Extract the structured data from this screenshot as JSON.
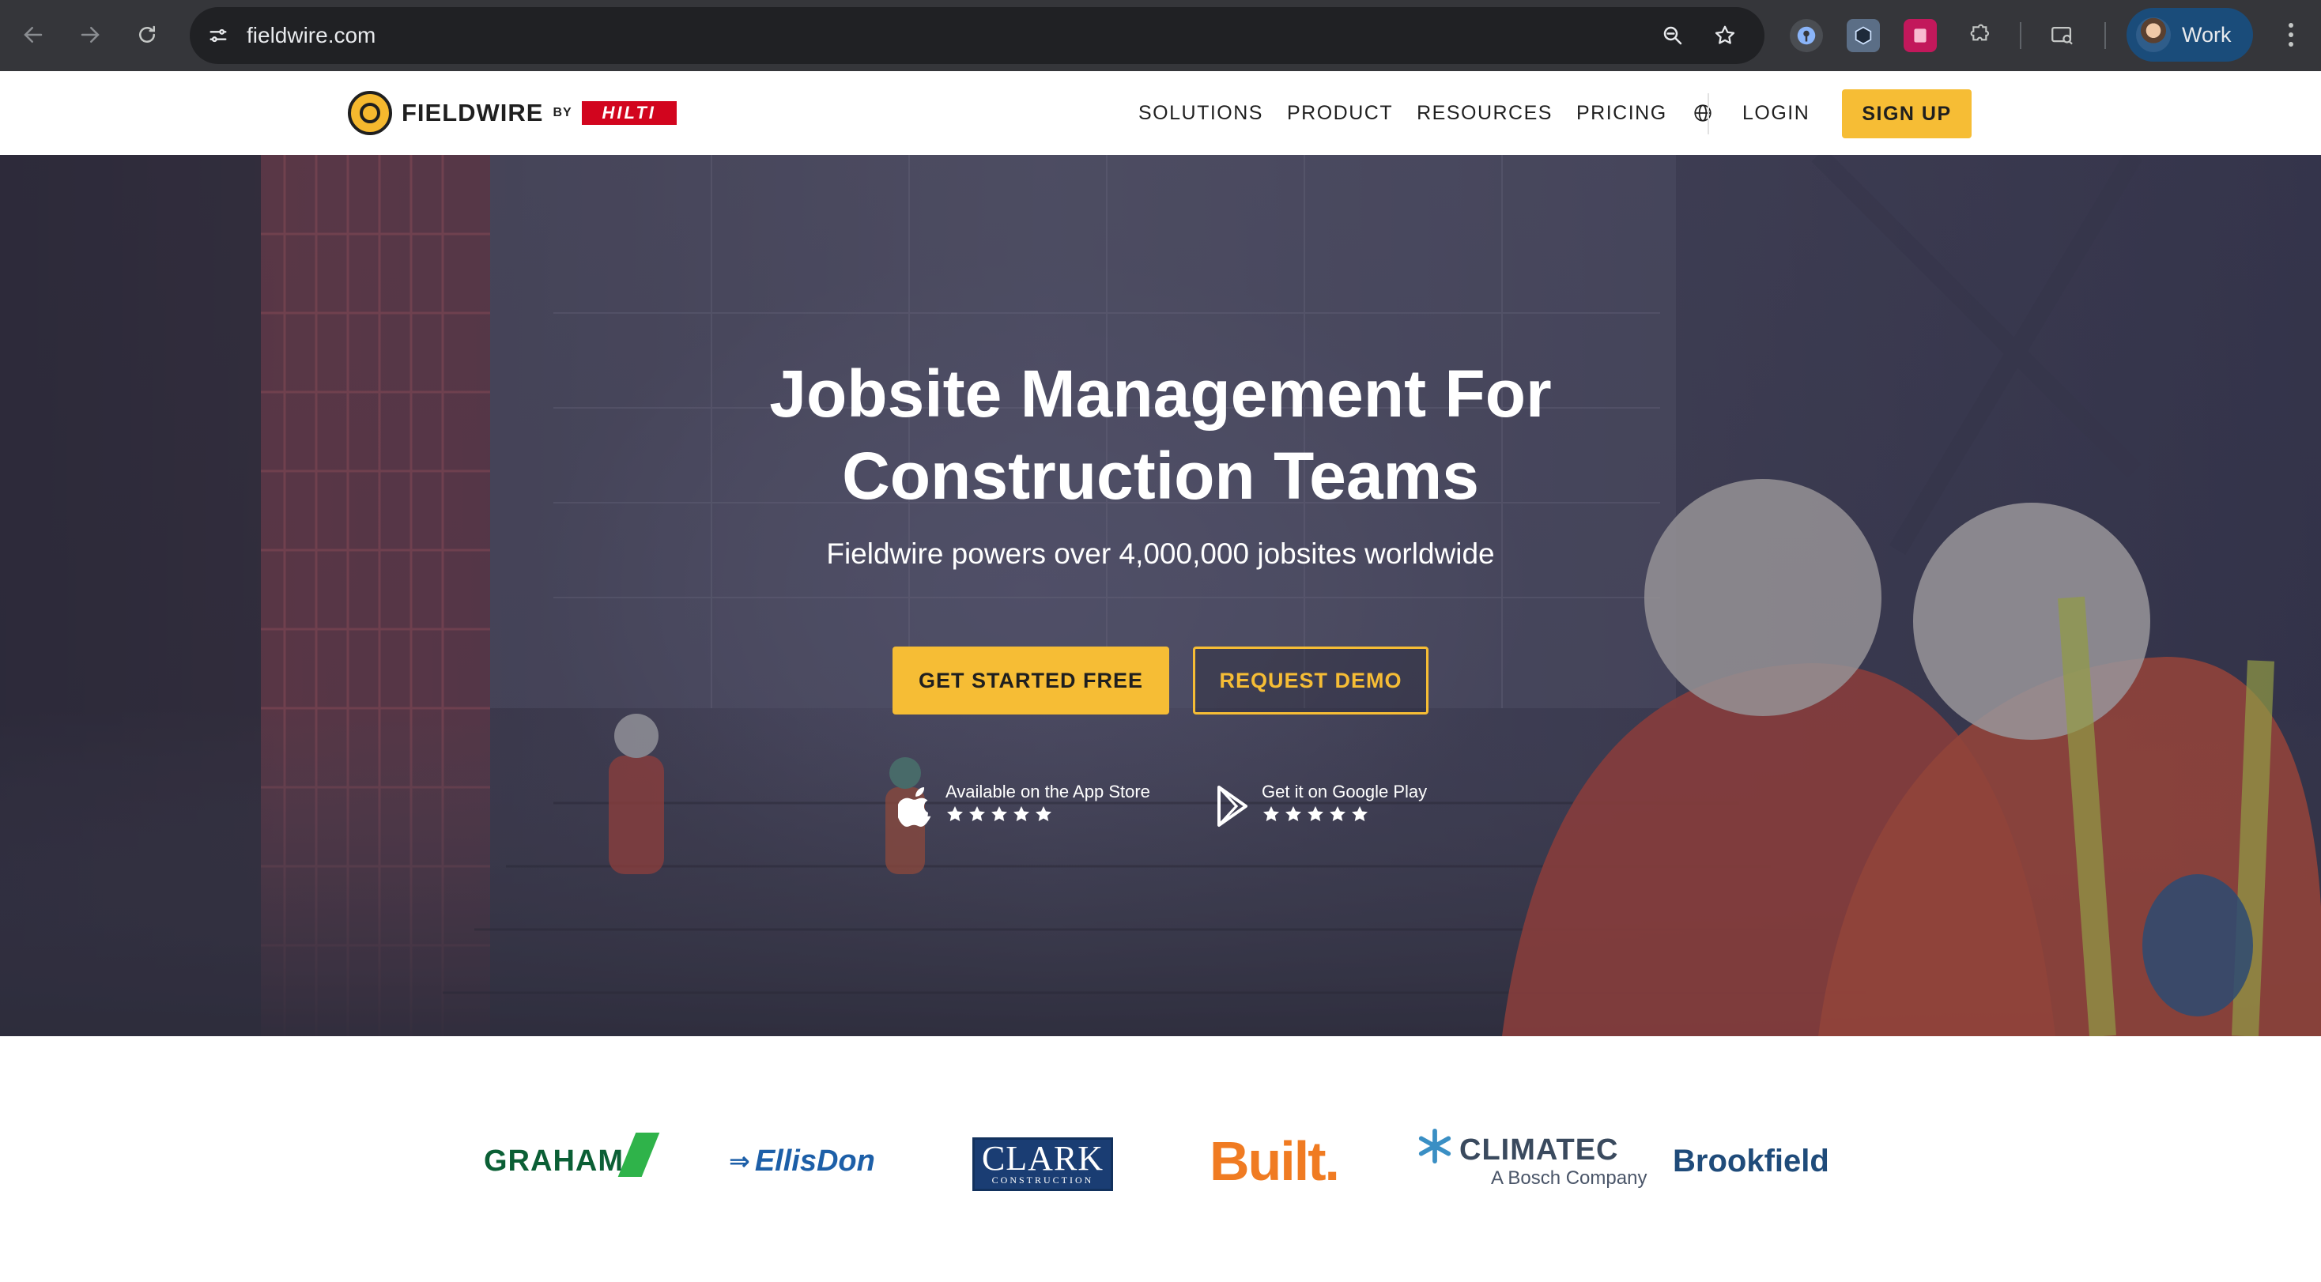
{
  "browser": {
    "url": "fieldwire.com",
    "profile_label": "Work"
  },
  "site": {
    "logo_word": "FIELDWIRE",
    "logo_by": "BY",
    "logo_partner": "HILTI",
    "nav": [
      "SOLUTIONS",
      "PRODUCT",
      "RESOURCES",
      "PRICING"
    ],
    "login_label": "LOGIN",
    "signup_label": "SIGN UP"
  },
  "hero": {
    "title_line1": "Jobsite Management For",
    "title_line2": "Construction Teams",
    "subtitle": "Fieldwire powers over 4,000,000 jobsites worldwide",
    "primary_cta": "GET STARTED FREE",
    "secondary_cta": "REQUEST DEMO",
    "app_store": {
      "label": "Available on the App Store",
      "rating": 5
    },
    "google_play": {
      "label": "Get it on Google Play",
      "rating": 5
    }
  },
  "clients": {
    "graham": "GRAHAM",
    "ellisdon": "EllisDon",
    "clark_main": "CLARK",
    "clark_sub": "CONSTRUCTION",
    "built": "Built.",
    "climatec_main": "CLIMATEC",
    "climatec_sub": "A Bosch Company",
    "brookfield": "Brookfield"
  },
  "colors": {
    "accent": "#f6bd35",
    "chrome_bg": "#35363a",
    "omnibox_bg": "#202124",
    "hilti_red": "#d2051e"
  }
}
